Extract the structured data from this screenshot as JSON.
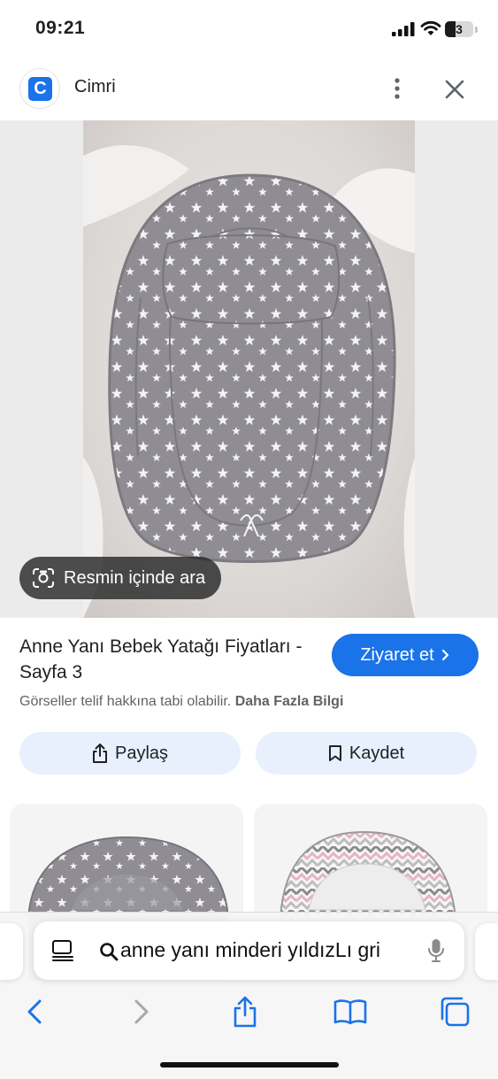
{
  "status_bar": {
    "time": "09:21",
    "battery": "3"
  },
  "header": {
    "site_logo_letter": "C",
    "site_name": "Cimri"
  },
  "image": {
    "lens_label": "Resmin içinde ara"
  },
  "result": {
    "title": "Anne Yanı Bebek Yatağı Fiyatları - Sayfa 3",
    "visit_label": "Ziyaret et",
    "copyright_text": "Görseller telif hakkına tabi olabilir.",
    "more_info_label": "Daha Fazla Bilgi",
    "share_label": "Paylaş",
    "save_label": "Kaydet"
  },
  "browser": {
    "address_text": "anne yanı minderi yıldızLı gri"
  },
  "colors": {
    "accent": "#1a73e8",
    "tonal_button": "#e8f0fe"
  }
}
